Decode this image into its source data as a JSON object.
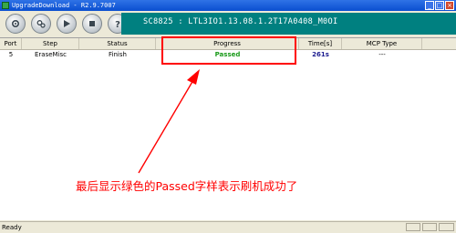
{
  "window": {
    "title": "UpgradeDownload - R2.9.7007"
  },
  "titlebar_buttons": [
    "_",
    "□",
    "×"
  ],
  "toolbar": {
    "buttons": [
      {
        "name": "settings-button",
        "icon": "gear-icon"
      },
      {
        "name": "packet-button",
        "icon": "gears-icon"
      },
      {
        "name": "start-button",
        "icon": "play-icon"
      },
      {
        "name": "stop-button",
        "icon": "stop-icon"
      },
      {
        "name": "help-button",
        "icon": "question-icon"
      }
    ],
    "device_info": "SC8825 : LTL3IO1.13.08.1.2T17A0408_M0OI"
  },
  "table": {
    "headers": [
      "Port",
      "Step",
      "Status",
      "Progress",
      "Time[s]",
      "MCP Type"
    ],
    "rows": [
      {
        "port": "5",
        "step": "EraseMisc",
        "status": "Finish",
        "progress": "Passed",
        "time": "261s",
        "mcp": "---"
      }
    ]
  },
  "annotation": {
    "text": "最后显示绿色的Passed字样表示刷机成功了",
    "color": "#ff0000"
  },
  "status": {
    "text": "Ready"
  },
  "colors": {
    "passed": "#1a9a1a",
    "device_bar": "#008080",
    "highlight": "#ff0000"
  }
}
